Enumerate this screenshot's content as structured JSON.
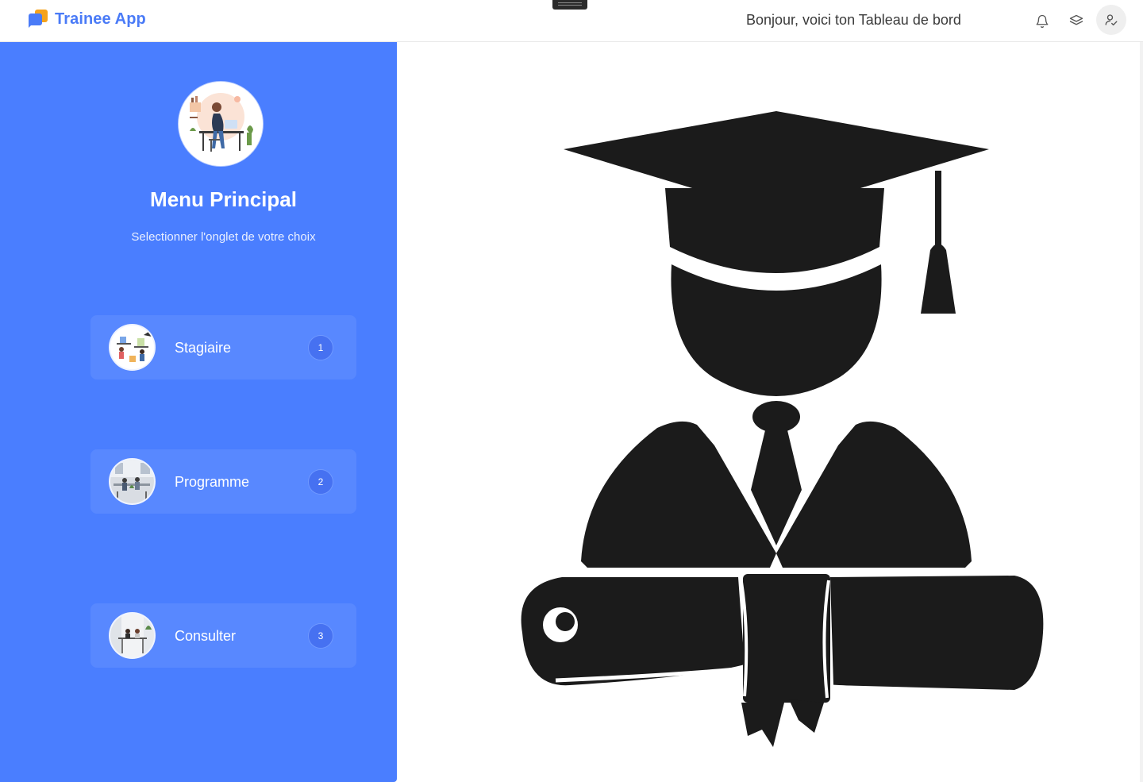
{
  "app": {
    "name": "Trainee App",
    "brand_color": "#4a7bf7",
    "accent_color": "#f6a31b"
  },
  "header": {
    "greeting": "Bonjour, voici ton Tableau de bord",
    "icons": [
      "bell-icon",
      "layers-icon",
      "user-check-icon"
    ]
  },
  "sidebar": {
    "background_color": "#4a7eff",
    "title": "Menu Principal",
    "subtitle": "Selectionner l'onglet de votre choix",
    "items": [
      {
        "label": "Stagiaire",
        "badge": "1"
      },
      {
        "label": "Programme",
        "badge": "2"
      },
      {
        "label": "Consulter",
        "badge": "3"
      }
    ]
  },
  "main": {
    "illustration": "graduate-cap-diploma-icon"
  }
}
